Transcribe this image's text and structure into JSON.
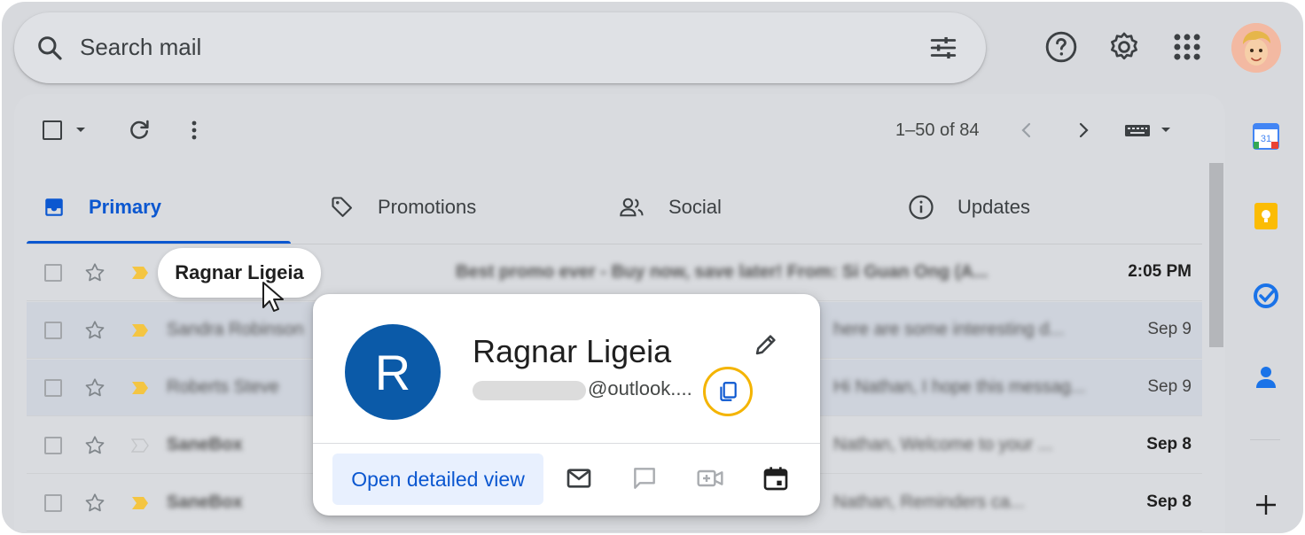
{
  "search": {
    "placeholder": "Search mail"
  },
  "header": {
    "icons": [
      "help-icon",
      "settings-icon",
      "apps-icon"
    ],
    "avatar": "account-avatar"
  },
  "toolbar": {
    "pager_text": "1–50 of 84"
  },
  "tabs": [
    {
      "label": "Primary",
      "icon": "inbox-icon",
      "active": true
    },
    {
      "label": "Promotions",
      "icon": "tag-icon",
      "active": false
    },
    {
      "label": "Social",
      "icon": "people-icon",
      "active": false
    },
    {
      "label": "Updates",
      "icon": "info-icon",
      "active": false
    }
  ],
  "emails": [
    {
      "sender": "Ragnar Ligeia",
      "subject": "Best promo ever - Buy now, save later! From: Si Guan Ong (A...",
      "date": "2:05 PM",
      "unread": true
    },
    {
      "sender": "Sandra Robinson",
      "subject": "here are some interesting d...",
      "date": "Sep 9",
      "unread": false
    },
    {
      "sender": "Roberts Steve",
      "subject": "Hi Nathan, I hope this messag...",
      "date": "Sep 9",
      "unread": false
    },
    {
      "sender": "SaneBox",
      "subject": "Nathan, Welcome to your ...",
      "date": "Sep 8",
      "unread": true
    },
    {
      "sender": "SaneBox",
      "subject": "Nathan, Reminders ca...",
      "date": "Sep 8",
      "unread": true
    }
  ],
  "hover_chip": {
    "name": "Ragnar Ligeia"
  },
  "contact_card": {
    "initial": "R",
    "name": "Ragnar Ligeia",
    "email_domain": "@outlook....",
    "detail_button": "Open detailed view",
    "avatar_color": "#0b5aa8",
    "highlight_color": "#f4b400"
  },
  "colors": {
    "accent": "#0b57d0",
    "background": "#d7d9dd"
  }
}
